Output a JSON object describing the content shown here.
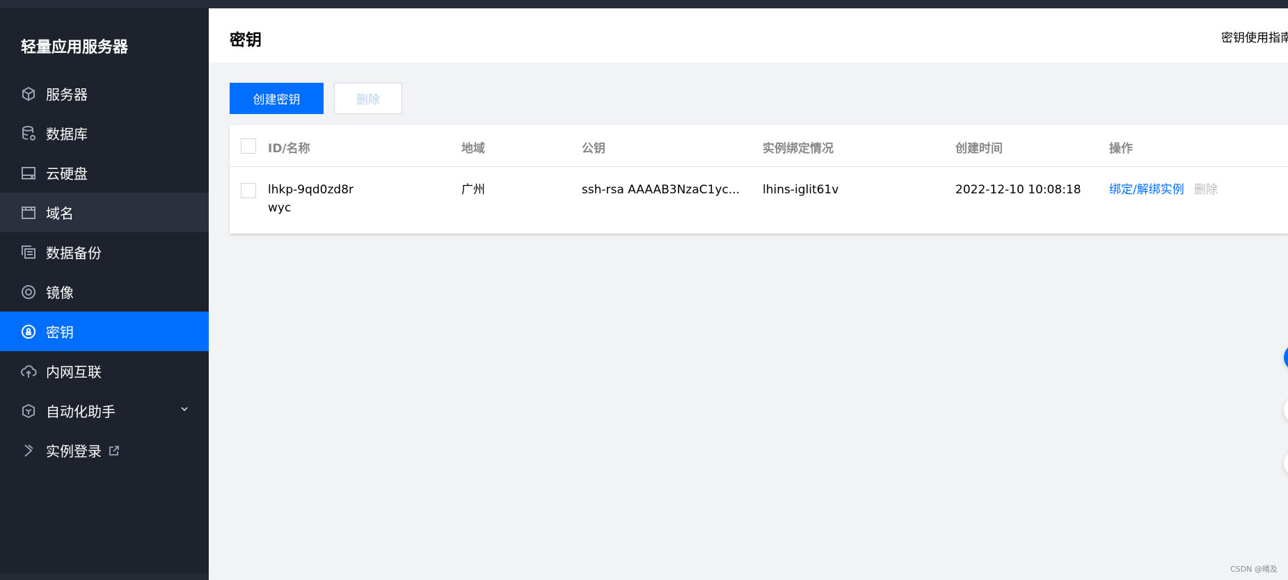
{
  "app": {
    "title": "轻量应用服务器"
  },
  "sidebar": {
    "items": [
      {
        "label": "服务器",
        "icon": "cube-icon"
      },
      {
        "label": "数据库",
        "icon": "database-icon"
      },
      {
        "label": "云硬盘",
        "icon": "disk-icon"
      },
      {
        "label": "域名",
        "icon": "domain-icon"
      },
      {
        "label": "数据备份",
        "icon": "backup-icon"
      },
      {
        "label": "镜像",
        "icon": "image-icon"
      },
      {
        "label": "密钥",
        "icon": "key-icon",
        "active": true
      },
      {
        "label": "内网互联",
        "icon": "network-icon"
      },
      {
        "label": "自动化助手",
        "icon": "automation-icon"
      },
      {
        "label": "实例登录",
        "icon": "login-icon"
      }
    ]
  },
  "header": {
    "title": "密钥",
    "guide_link": "密钥使用指南"
  },
  "toolbar": {
    "create_label": "创建密钥",
    "delete_label": "删除"
  },
  "table": {
    "columns": [
      "ID/名称",
      "地域",
      "公钥",
      "实例绑定情况",
      "创建时间",
      "操作"
    ],
    "rows": [
      {
        "id": "lhkp-9qd0zd8r",
        "name": "wyc",
        "region": "广州",
        "public_key": "ssh-rsa AAAAB3NzaC1yc...",
        "binding": "lhins-iglit61v",
        "created": "2022-12-10 10:08:18",
        "action_bind": "绑定/解绑实例",
        "action_delete": "删除"
      }
    ]
  },
  "watermark": "CSDN @晴及",
  "colors": {
    "accent": "#006eff",
    "sidebar": "#1e222d"
  }
}
